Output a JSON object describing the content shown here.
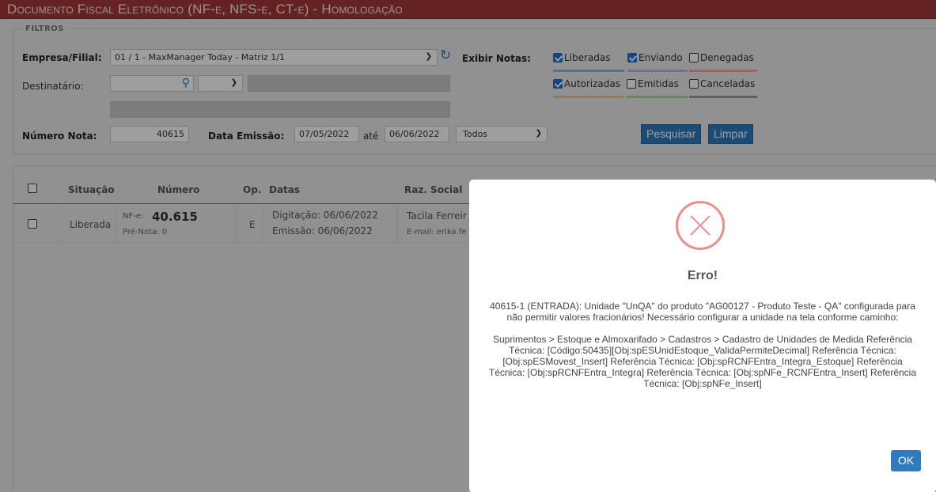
{
  "header": {
    "title": "Documento Fiscal Eletrônico (NF-e, NFS-e, CT-e)  - Homologação"
  },
  "filters": {
    "legend": "Filtros",
    "empresa_label": "Empresa/Filial:",
    "empresa_value": "01 / 1 - MaxManager Today - Matriz 1/1",
    "destinatario_label": "Destinatário:",
    "numero_label": "Número Nota:",
    "numero_value": "40615",
    "data_label": "Data Emissão:",
    "data_de": "07/05/2022",
    "ate_label": "até",
    "data_ate": "06/06/2022",
    "tipo_value": "Todos",
    "exibir_label": "Exibir Notas:",
    "checks": [
      {
        "label": "Liberadas",
        "checked": true,
        "color": "#8fb6e0"
      },
      {
        "label": "Enviando",
        "checked": true,
        "color": "#c0b2dc"
      },
      {
        "label": "Denegadas",
        "checked": false,
        "color": "#f2a6a6"
      },
      {
        "label": "Autorizadas",
        "checked": true,
        "color": "#f5c08f"
      },
      {
        "label": "Emitidas",
        "checked": false,
        "color": "#a8d8a0"
      },
      {
        "label": "Canceladas",
        "checked": false,
        "color": "#9a9a9a"
      }
    ],
    "pesquisar": "Pesquisar",
    "limpar": "Limpar"
  },
  "table": {
    "headers": {
      "situacao": "Situação",
      "numero": "Número",
      "op": "Op.",
      "datas": "Datas",
      "razao": "Raz. Social"
    },
    "row": {
      "situacao": "Liberada",
      "nfe_prefix": "NF-e:",
      "numero": "40.615",
      "pre_nota": "Pré-Nota: 0",
      "op": "E",
      "digitacao": "Digitação: 06/06/2022",
      "emissao": "Emissão: 06/06/2022",
      "razao": "Tacila Ferreir",
      "email": "E-mail: erika.fe"
    }
  },
  "modal": {
    "title": "Erro!",
    "message": "40615-1 (ENTRADA): Unidade \"UnQA\" do produto \"AG00127 - Produto Teste - QA\" configurada para não permitir valores fracionários! Necessário configurar a unidade na tela conforme caminho:\n\nSuprimentos > Estoque e Almoxarifado > Cadastros > Cadastro de Unidades de Medida Referência Técnica: [Código:50435][Obj:spESUnidEstoque_ValidaPermiteDecimal] Referência Técnica: [Obj:spESMovest_Insert] Referência Técnica: [Obj:spRCNFEntra_Integra_Estoque] Referência Técnica: [Obj:spRCNFEntra_Integra] Referência Técnica: [Obj:spNFe_RCNFEntra_Insert] Referência Técnica: [Obj:spNFe_Insert]",
    "ok": "OK"
  }
}
